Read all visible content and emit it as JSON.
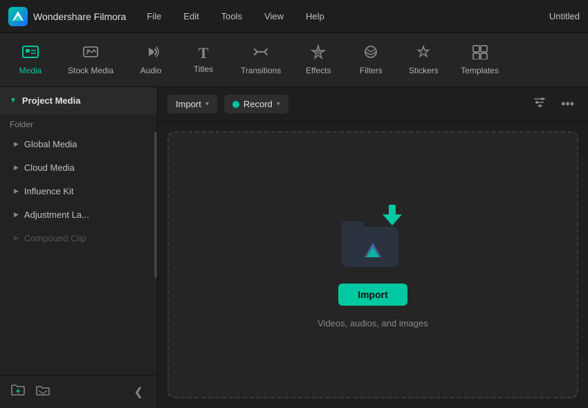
{
  "titleBar": {
    "appName": "Wondershare Filmora",
    "menuItems": [
      "File",
      "Edit",
      "Tools",
      "View",
      "Help"
    ],
    "windowTitle": "Untitled"
  },
  "tabs": [
    {
      "id": "media",
      "label": "Media",
      "icon": "🎬",
      "active": true
    },
    {
      "id": "stock-media",
      "label": "Stock Media",
      "icon": "📁"
    },
    {
      "id": "audio",
      "label": "Audio",
      "icon": "🎵"
    },
    {
      "id": "titles",
      "label": "Titles",
      "icon": "T"
    },
    {
      "id": "transitions",
      "label": "Transitions",
      "icon": "↔"
    },
    {
      "id": "effects",
      "label": "Effects",
      "icon": "✨"
    },
    {
      "id": "filters",
      "label": "Filters",
      "icon": "🎨"
    },
    {
      "id": "stickers",
      "label": "Stickers",
      "icon": "⭐"
    },
    {
      "id": "templates",
      "label": "Templates",
      "icon": "⊞"
    }
  ],
  "sidebar": {
    "header": {
      "label": "Project Media",
      "arrow": "▼"
    },
    "sectionLabel": "Folder",
    "items": [
      {
        "id": "global-media",
        "label": "Global Media",
        "arrow": "▶"
      },
      {
        "id": "cloud-media",
        "label": "Cloud Media",
        "arrow": "▶"
      },
      {
        "id": "influence-kit",
        "label": "Influence Kit",
        "arrow": "▶"
      },
      {
        "id": "adjustment-la",
        "label": "Adjustment La...",
        "arrow": "▶"
      },
      {
        "id": "compound-clip",
        "label": "Compound Clip",
        "arrow": "▶",
        "faded": true
      }
    ],
    "footer": {
      "newFolderLabel": "📁+",
      "newFolderAlt": "📁",
      "collapseLabel": "❮"
    }
  },
  "mediaPanel": {
    "toolbar": {
      "importLabel": "Import",
      "importArrow": "▾",
      "recordLabel": "Record",
      "recordArrow": "▾",
      "filterIcon": "filter",
      "moreIcon": "•••"
    },
    "dropZone": {
      "importButtonLabel": "Import",
      "hintText": "Videos, audios, and images"
    }
  }
}
